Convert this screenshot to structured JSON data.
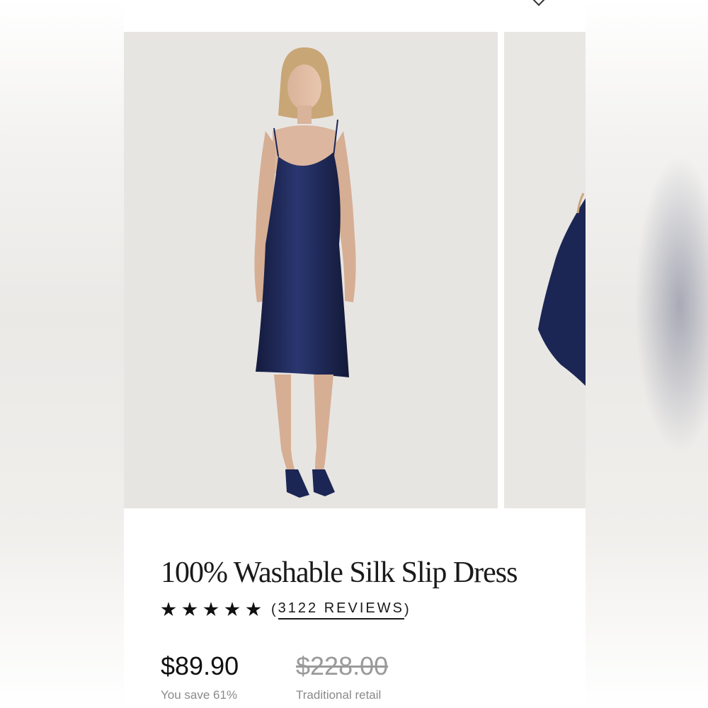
{
  "product": {
    "title": "100% Washable Silk Slip Dress",
    "rating": {
      "stars": 5,
      "max": 5,
      "open_paren": "(",
      "reviews_label": "3122 REVIEWS",
      "close_paren": ")"
    },
    "price": "$89.90",
    "savings": "You save 61%",
    "original_price": "$228.00",
    "original_label": "Traditional retail"
  },
  "gallery": {
    "images": [
      {
        "icon": "model-in-navy-slip-dress-image"
      },
      {
        "icon": "dress-detail-image"
      }
    ]
  },
  "colors": {
    "dress": "#1c2654",
    "background": "#e7e5e2",
    "text": "#1a1a1a",
    "muted": "#8a8a8a"
  }
}
